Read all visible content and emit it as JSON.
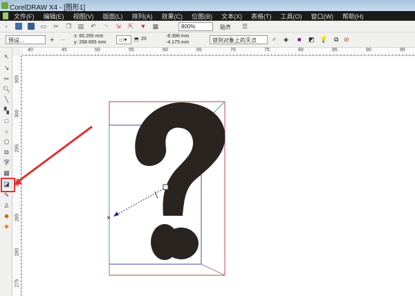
{
  "window": {
    "title": "CorelDRAW X4 - [图形1]"
  },
  "menu": [
    "文件(F)",
    "编辑(E)",
    "视图(V)",
    "版面(L)",
    "排列(A)",
    "效果(C)",
    "位图(B)",
    "文本(X)",
    "表格(T)",
    "工具(O)",
    "窗口(W)",
    "帮助(H)"
  ],
  "standard_toolbar": {
    "zoom": "800%",
    "snap": "贴齐"
  },
  "property_bar": {
    "preset": "预设...",
    "x": "x: 60.265 mm",
    "y": "y: 268.665 mm",
    "depth": "20",
    "vp_x": "-8.398 mm",
    "vp_y": "-4.175 mm",
    "vanishing_point_lock": "锁到对象上的灭点"
  },
  "ruler": {
    "h_labels": [
      "40",
      "45",
      "50",
      "55",
      "60",
      "65",
      "70",
      "75",
      "80",
      "85",
      "90",
      "95"
    ],
    "v_labels": [
      "305",
      "300",
      "295",
      "290",
      "285",
      "280",
      "275"
    ]
  },
  "tools": [
    "pick-tool",
    "shape-tool",
    "crop-tool",
    "zoom-tool",
    "freehand-tool",
    "smart-fill-tool",
    "rectangle-tool",
    "ellipse-tool",
    "polygon-tool",
    "basic-shapes-tool",
    "text-tool",
    "table-tool",
    "interactive-extrude-tool",
    "eyedropper-tool",
    "outline-tool",
    "fill-tool",
    "interactive-fill-tool"
  ],
  "canvas": {
    "glyph": "?",
    "glyph_color": "#2a2421",
    "highlight_color": "#e03030"
  }
}
